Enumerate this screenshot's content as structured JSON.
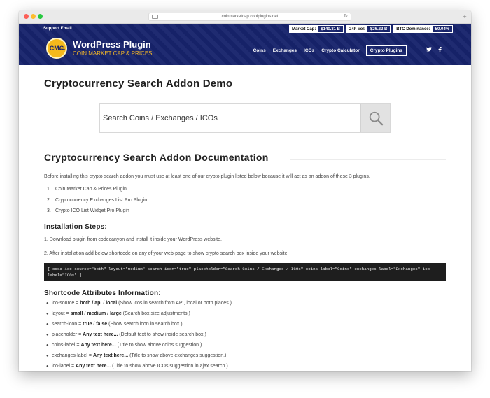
{
  "browser": {
    "url": "coinmarketcap.coolplugins.net"
  },
  "header": {
    "support": "Support Email",
    "stats": [
      {
        "label": "Market Cap:",
        "value": "$140.31 B"
      },
      {
        "label": "24h Vol:",
        "value": "$26.22 B"
      },
      {
        "label": "BTC Dominance:",
        "value": "50.04%"
      }
    ],
    "logo_badge": "CMC",
    "logo_badge_small": "PRO",
    "logo_title": "WordPress Plugin",
    "logo_subtitle": "COIN MARKET CAP & PRICES",
    "nav": [
      "Coins",
      "Exchanges",
      "ICOs",
      "Crypto Calculator",
      "Crypto Plugins"
    ],
    "social": [
      "twitter-icon",
      "facebook-icon"
    ]
  },
  "main": {
    "title": "Cryptocurrency Search Addon Demo",
    "search_placeholder": "Search Coins / Exchanges / ICOs",
    "doc_title": "Cryptocurrency Search Addon Documentation",
    "intro": "Before installing this crypto search addon you must use at least one of our crypto plugin listed below because it will act as an addon of these 3 plugins.",
    "plugins": [
      {
        "num": "1.",
        "text": "Coin Market Cap & Prices Plugin"
      },
      {
        "num": "2.",
        "text": "Cryptocurrency Exchanges List Pro Plugin"
      },
      {
        "num": "3.",
        "text": "Crypto ICO List Widget Pro Plugin"
      }
    ],
    "install_heading": "Installation Steps:",
    "step1": "1. Download plugin from codecanyon and install it inside your WordPress website.",
    "step2": "2. After installation add below shortcode on any of your web-page to show crypto search box inside your website.",
    "code_line1": "[ ccsa ico-source=\"both\" layout=\"medium\" search-icon=\"true\" placeholder=\"Search Coins / Exchanges / ICOs\" coins-label=\"Coins\" exchanges-label=\"Exchanges\" ico-",
    "code_line2": "label=\"ICOs\" ]",
    "attr_heading": "Shortcode Attributes Information:",
    "attributes": [
      {
        "name": "ico-source = ",
        "value": "both / api / local",
        "desc": " (Show icos in search from API, local or both places.)"
      },
      {
        "name": "layout = ",
        "value": "small / medium / large",
        "desc": " (Search box size adjustments.)"
      },
      {
        "name": "search-icon = ",
        "value": "true / false",
        "desc": " (Show search icon in search box.)"
      },
      {
        "name": "placeholder = ",
        "value": "Any text here...",
        "desc": " (Default text to show inside search box.)"
      },
      {
        "name": "coins-label = ",
        "value": "Any text here...",
        "desc": " (Title to show above coins suggestion.)"
      },
      {
        "name": "exchanges-label = ",
        "value": "Any text here...",
        "desc": " (Title to show above exchanges suggestion.)"
      },
      {
        "name": "ico-label = ",
        "value": "Any text here...",
        "desc": " (Title to show above ICOs suggestion in ajax search.)"
      }
    ]
  },
  "colors": {
    "header_bg": "#17236c",
    "accent_gold": "#f4b727",
    "code_bg": "#1e1e1e"
  }
}
